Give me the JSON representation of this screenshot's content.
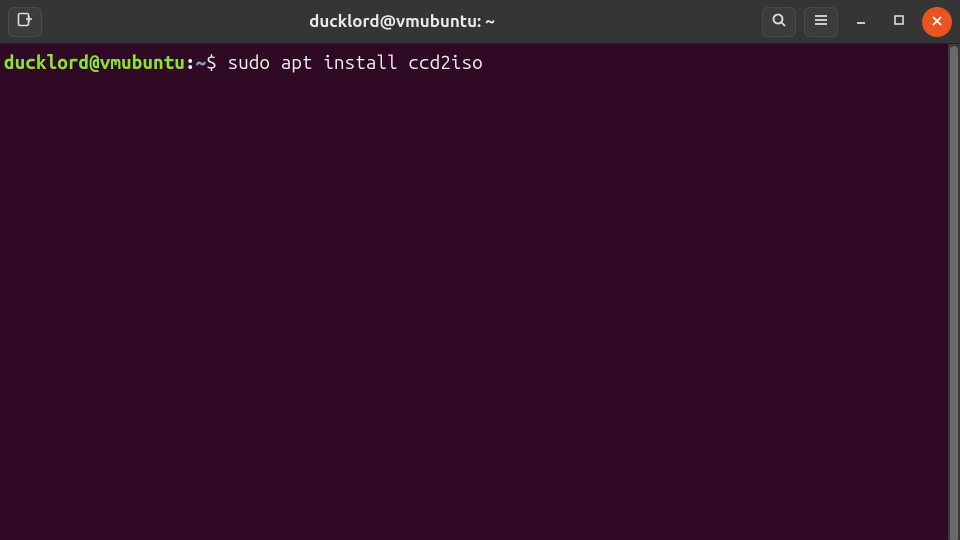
{
  "colors": {
    "titlebar_bg": "#353535",
    "terminal_bg": "#300a24",
    "prompt_user": "#8ae234",
    "prompt_path": "#729fcf",
    "text": "#eeeeec",
    "close_btn": "#e95420"
  },
  "titlebar": {
    "title": "ducklord@vmubuntu: ~",
    "new_tab_icon": "new-tab-icon",
    "search_icon": "search-icon",
    "menu_icon": "hamburger-icon",
    "minimize_icon": "minimize-icon",
    "maximize_icon": "maximize-icon",
    "close_icon": "close-icon"
  },
  "terminal": {
    "prompt": {
      "user_host": "ducklord@vmubuntu",
      "separator": ":",
      "path": "~",
      "symbol": "$"
    },
    "command": "sudo apt install ccd2iso"
  }
}
